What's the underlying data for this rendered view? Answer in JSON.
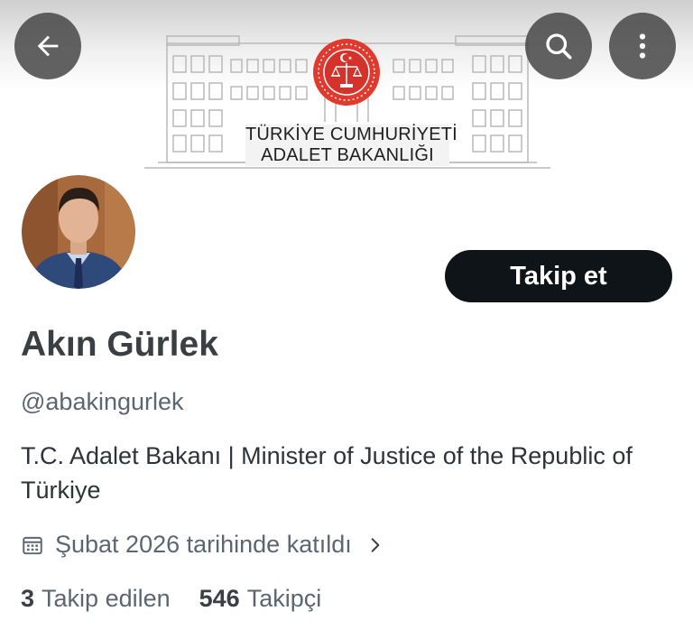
{
  "banner": {
    "line1": "TÜRKİYE CUMHURİYETİ",
    "line2": "ADALET BAKANLIĞI",
    "emblem_color": "#e03a2f"
  },
  "nav": {
    "back_icon": "arrow-left-icon",
    "search_icon": "search-icon",
    "more_icon": "more-vertical-icon"
  },
  "profile": {
    "display_name": "Akın Gürlek",
    "handle": "@abakingurlek",
    "bio": "T.C. Adalet Bakanı | Minister of Justice of the Republic of Türkiye",
    "joined": "Şubat 2026 tarihinde katıldı",
    "follow_label": "Takip et"
  },
  "stats": {
    "following_count": "3",
    "following_label": "Takip edilen",
    "followers_count": "546",
    "followers_label": "Takipçi"
  },
  "colors": {
    "follow_button_bg": "#0f1419",
    "secondary_text": "#5b6670"
  }
}
